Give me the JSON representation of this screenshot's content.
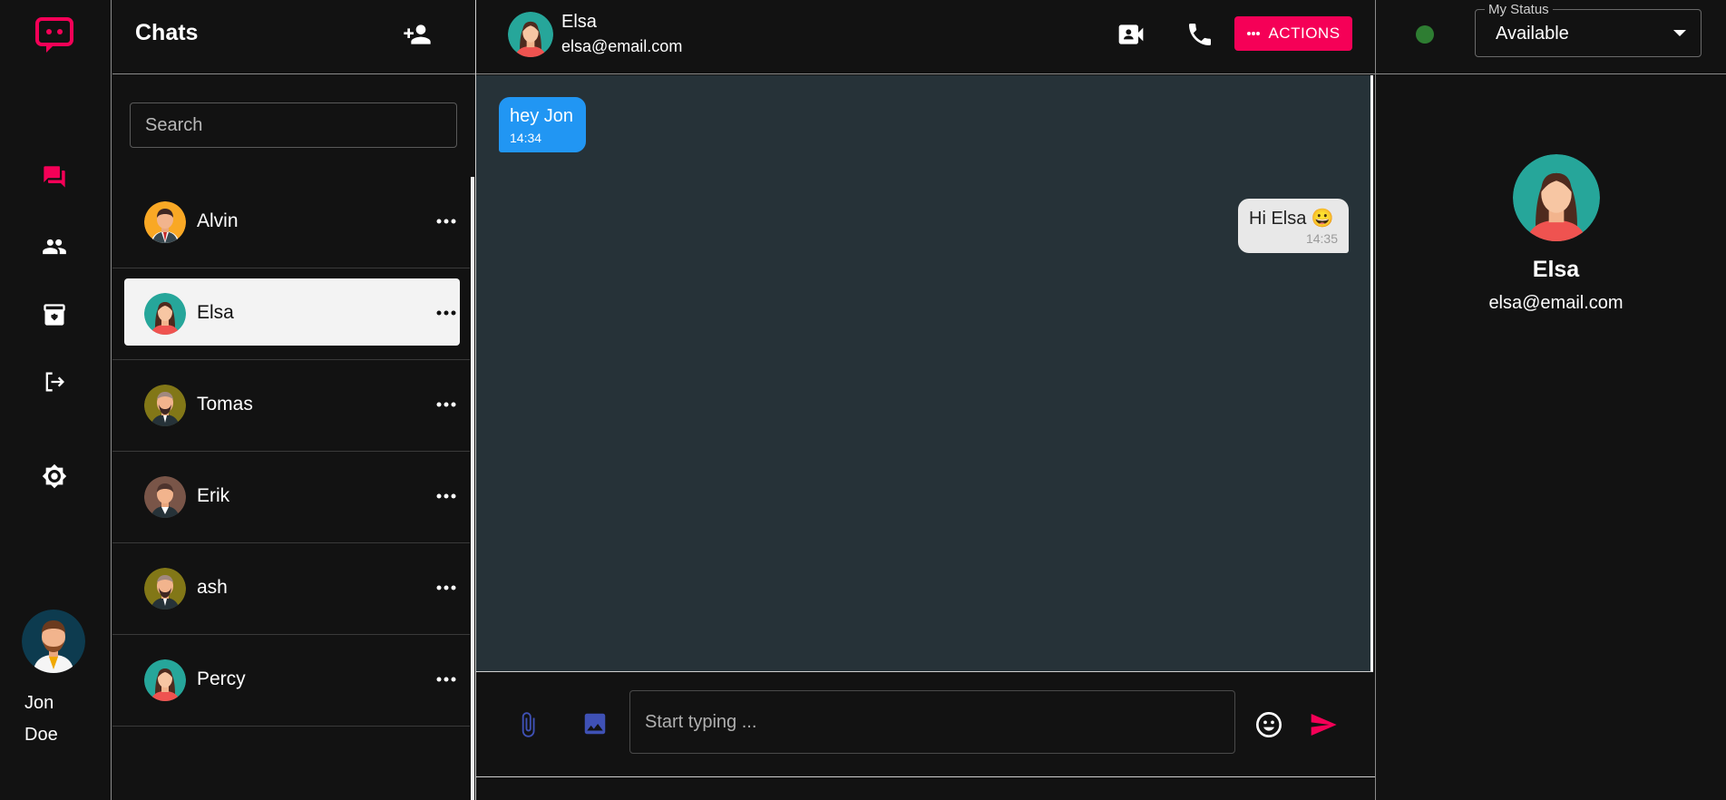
{
  "user": {
    "first_name": "Jon",
    "last_name": "Doe"
  },
  "nav": {
    "items": [
      "chats",
      "contacts",
      "archive",
      "logout",
      "theme"
    ]
  },
  "chats_panel": {
    "title": "Chats",
    "search_placeholder": "Search",
    "items": [
      {
        "name": "Alvin",
        "avatar": "man-tie-icon",
        "selected": false
      },
      {
        "name": "Elsa",
        "avatar": "woman-icon",
        "selected": true
      },
      {
        "name": "Tomas",
        "avatar": "man-beard-icon",
        "selected": false
      },
      {
        "name": "Erik",
        "avatar": "man-icon",
        "selected": false
      },
      {
        "name": "ash",
        "avatar": "man-beard-icon",
        "selected": false
      },
      {
        "name": "Percy",
        "avatar": "woman-icon",
        "selected": false
      }
    ]
  },
  "conversation": {
    "contact_name": "Elsa",
    "contact_email": "elsa@email.com",
    "actions_label": "ACTIONS",
    "messages": [
      {
        "text": "hey Jon",
        "time": "14:34",
        "direction": "incoming"
      },
      {
        "text": "Hi Elsa 😀",
        "time": "14:35",
        "direction": "outgoing"
      }
    ],
    "input_placeholder": "Start typing ..."
  },
  "status": {
    "legend": "My Status",
    "value": "Available",
    "dot_color": "#2e7d32"
  },
  "profile": {
    "name": "Elsa",
    "email": "elsa@email.com"
  },
  "colors": {
    "accent": "#f50057",
    "incoming_bubble": "#2196f3",
    "chat_bg": "#263238"
  }
}
